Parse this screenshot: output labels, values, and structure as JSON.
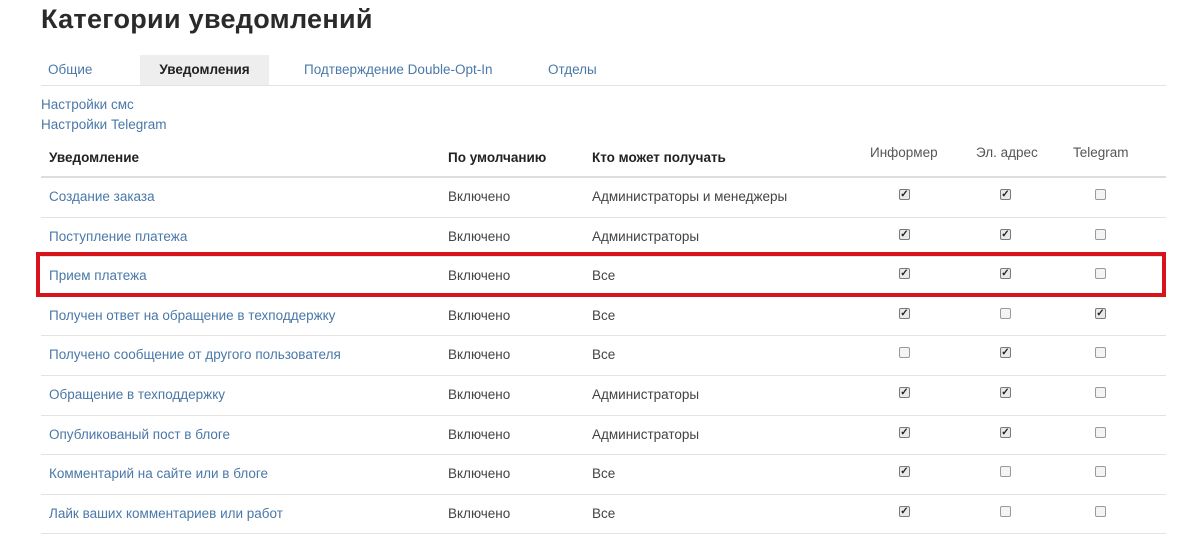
{
  "page": {
    "title": "Категории уведомлений"
  },
  "tabs": [
    {
      "label": "Общие",
      "active": false
    },
    {
      "label": "Уведомления",
      "active": true
    },
    {
      "label": "Подтверждение Double-Opt-In",
      "active": false
    },
    {
      "label": "Отделы",
      "active": false
    }
  ],
  "links": {
    "sms": "Настройки смс",
    "telegram": "Настройки Telegram"
  },
  "table": {
    "columns": {
      "notification": "Уведомление",
      "default": "По умолчанию",
      "recipients": "Кто может получать",
      "informer": "Информер",
      "email": "Эл. адрес",
      "telegram": "Telegram"
    },
    "rows": [
      {
        "name": "Создание заказа",
        "default": "Включено",
        "recipients": "Администраторы и менеджеры",
        "informer": true,
        "email": true,
        "telegram": false
      },
      {
        "name": "Поступление платежа",
        "default": "Включено",
        "recipients": "Администраторы",
        "informer": true,
        "email": true,
        "telegram": false
      },
      {
        "name": "Прием платежа",
        "default": "Включено",
        "recipients": "Все",
        "informer": true,
        "email": true,
        "telegram": false
      },
      {
        "name": "Получен ответ на обращение в техподдержку",
        "default": "Включено",
        "recipients": "Все",
        "informer": true,
        "email": false,
        "telegram": true
      },
      {
        "name": "Получено сообщение от другого пользователя",
        "default": "Включено",
        "recipients": "Все",
        "informer": false,
        "email": true,
        "telegram": false
      },
      {
        "name": "Обращение в техподдержку",
        "default": "Включено",
        "recipients": "Администраторы",
        "informer": true,
        "email": true,
        "telegram": false
      },
      {
        "name": "Опубликованый пост в блоге",
        "default": "Включено",
        "recipients": "Администраторы",
        "informer": true,
        "email": true,
        "telegram": false
      },
      {
        "name": "Комментарий на сайте или в блоге",
        "default": "Включено",
        "recipients": "Все",
        "informer": true,
        "email": false,
        "telegram": false
      },
      {
        "name": "Лайк ваших комментариев или работ",
        "default": "Включено",
        "recipients": "Все",
        "informer": true,
        "email": false,
        "telegram": false
      }
    ]
  },
  "highlight": {
    "row_index": 2,
    "color": "#d7141b"
  },
  "colors": {
    "link": "#4a78a8",
    "active_tab_bg": "#eeeeee"
  }
}
